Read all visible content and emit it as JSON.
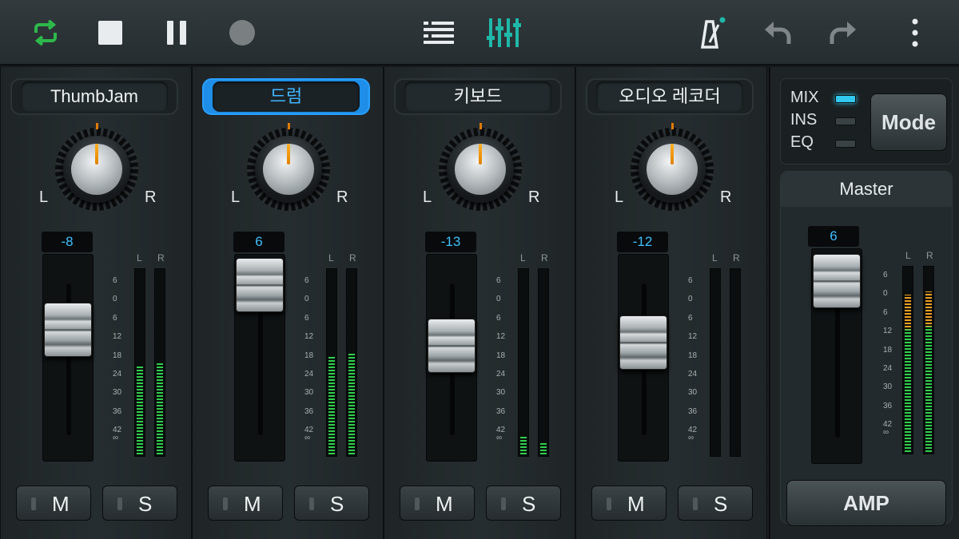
{
  "toolbar": {
    "icons": [
      "loop-icon",
      "stop-icon",
      "pause-icon",
      "record-icon",
      "track-list-icon",
      "mixer-icon",
      "metronome-icon",
      "undo-icon",
      "redo-icon",
      "more-menu-icon"
    ]
  },
  "channels": [
    {
      "name": "ThumbJam",
      "active": false,
      "pan_left": "L",
      "pan_right": "R",
      "fader_value": "-8",
      "meter_left": 0.47,
      "meter_right": 0.49,
      "mute": "M",
      "solo": "S"
    },
    {
      "name": "드럼",
      "active": true,
      "pan_left": "L",
      "pan_right": "R",
      "fader_value": "6",
      "meter_left": 0.52,
      "meter_right": 0.54,
      "mute": "M",
      "solo": "S"
    },
    {
      "name": "키보드",
      "active": false,
      "pan_left": "L",
      "pan_right": "R",
      "fader_value": "-13",
      "meter_left": 0.1,
      "meter_right": 0.06,
      "mute": "M",
      "solo": "S"
    },
    {
      "name": "오디오 레코더",
      "active": false,
      "pan_left": "L",
      "pan_right": "R",
      "fader_value": "-12",
      "meter_left": 0.0,
      "meter_right": 0.0,
      "mute": "M",
      "solo": "S"
    }
  ],
  "meter_labels": {
    "left": "L",
    "right": "R"
  },
  "scale_labels": [
    "6",
    "0",
    "6",
    "12",
    "18",
    "24",
    "30",
    "36",
    "42",
    "∞"
  ],
  "mode": {
    "rows": [
      "MIX",
      "INS",
      "EQ"
    ],
    "selected": "MIX",
    "button": "Mode"
  },
  "master": {
    "title": "Master",
    "fader_value": "6",
    "meter_left": 0.84,
    "meter_right": 0.86,
    "amp_button": "AMP"
  },
  "colors": {
    "accent": "#1e8ee8",
    "value_text": "#3fc0ff",
    "meter_green": "#2fd04a",
    "meter_orange": "#f0a020",
    "active_led": "#33c8f0",
    "mixer_icon": "#1fb8a8",
    "loop_icon": "#2db84a"
  }
}
